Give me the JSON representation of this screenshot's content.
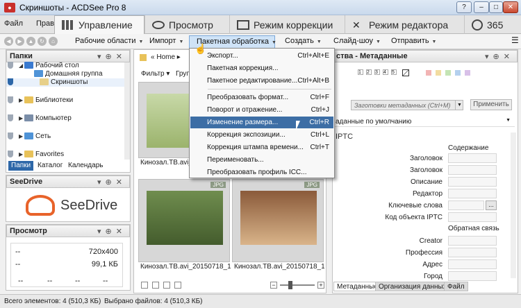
{
  "window": {
    "title": "Скриншоты - ACDSee Pro 8",
    "app_icon": "camera-icon"
  },
  "menu": {
    "file": "Файл",
    "edit": "Прав"
  },
  "mode_tabs": [
    {
      "label": "Управление",
      "icon": "grid-icon"
    },
    {
      "label": "Просмотр",
      "icon": "eye-icon"
    },
    {
      "label": "Режим коррекции",
      "icon": "photo-icon"
    },
    {
      "label": "Режим редактора",
      "icon": "tools-icon"
    },
    {
      "label": "365",
      "icon": "365-icon"
    }
  ],
  "toolbar": {
    "items": [
      "Рабочие области",
      "Импорт",
      "Пакетная обработка",
      "Создать",
      "Слайд-шоу",
      "Отправить"
    ]
  },
  "folders_panel": {
    "title": "Папки",
    "items": [
      {
        "label": "Рабочий стол"
      },
      {
        "label": "Домашняя группа"
      },
      {
        "label": "Скриншоты"
      },
      {
        "label": "Библиотеки"
      },
      {
        "label": "Компьютер"
      },
      {
        "label": "Сеть"
      },
      {
        "label": "Favorites"
      }
    ],
    "tabs": [
      "Папки",
      "Каталог",
      "Календарь"
    ]
  },
  "seedrive_panel": {
    "title": "SeeDrive",
    "logo_text": "SeeDrive"
  },
  "preview_panel": {
    "title": "Просмотр",
    "dimensions": "720x400",
    "size": "99,1 КБ",
    "dash": "--"
  },
  "browser": {
    "path": "Home",
    "filter_label": "Фильтр",
    "group_label": "Груп",
    "thumbnails": [
      {
        "caption": "Кинозал.ТВ.avi_2",
        "badge": ""
      },
      {
        "caption": "Кинозал.ТВ.avi_20150718_14...",
        "badge": "JPG"
      },
      {
        "caption": "Кинозал.ТВ.avi_20150718_14...",
        "badge": "JPG"
      }
    ]
  },
  "dropdown": {
    "items": [
      {
        "label": "Экспорт...",
        "shortcut": "Ctrl+Alt+E"
      },
      {
        "label": "Пакетная коррекция...",
        "shortcut": ""
      },
      {
        "label": "Пакетное редактирование...",
        "shortcut": "Ctrl+Alt+B"
      },
      {
        "label": "Преобразовать формат...",
        "shortcut": "Ctrl+F"
      },
      {
        "label": "Поворот и отражение...",
        "shortcut": "Ctrl+J"
      },
      {
        "label": "Изменение размера...",
        "shortcut": "Ctrl+R"
      },
      {
        "label": "Коррекция экспозиции...",
        "shortcut": "Ctrl+L"
      },
      {
        "label": "Коррекция штампа времени...",
        "shortcut": "Ctrl+T"
      },
      {
        "label": "Переименовать...",
        "shortcut": ""
      },
      {
        "label": "Преобразовать профиль ICC...",
        "shortcut": ""
      }
    ]
  },
  "properties_panel": {
    "title": "ства - Метаданные",
    "rating": [
      "1",
      "2",
      "3",
      "4",
      "5"
    ],
    "preset_placeholder": "Заготовки метаданных (Ctrl+M)",
    "apply_button": "Применить",
    "default_view": "аданные по умолчанию",
    "section": "IPTC",
    "content_header": "Содержание",
    "contact_header": "Обратная связь",
    "fields": [
      "Заголовок",
      "Заголовок",
      "Описание",
      "Редактор",
      "Ключевые слова",
      "Код объекта IPTC"
    ],
    "contact_fields": [
      "Creator",
      "Профессия",
      "Адрес",
      "Город"
    ],
    "bottom_tabs": [
      "Метаданные",
      "Организация данных",
      "Файл"
    ]
  },
  "statusbar": {
    "total": "Всего элементов: 4  (510,3 КБ)",
    "selected": "Выбрано файлов: 4  (510,3 КБ)"
  }
}
